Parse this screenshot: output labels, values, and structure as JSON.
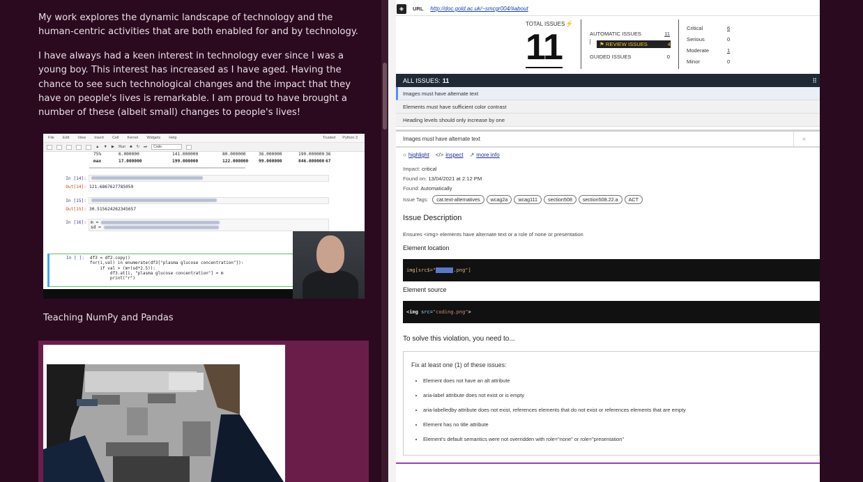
{
  "left": {
    "para1": "My work explores the dynamic landscape of technology and the human-centric activities that are both enabled for and by technology.",
    "para2": "I have always had a keen interest in technology ever since I was a young boy. This interest has increased as I have aged. Having the chance to see such technological changes and the impact that they have on people's lives is remarkable. I am proud to have brought a number of these (albeit small) changes to people's lives!",
    "caption": "Teaching NumPy and Pandas",
    "notebook": {
      "menu": [
        "File",
        "Edit",
        "View",
        "Insert",
        "Cell",
        "Kernel",
        "Widgets",
        "Help"
      ],
      "trusted": "Trusted",
      "kernel": "Python 3",
      "run_label": "Run",
      "cell_type": "Code",
      "table_rows": [
        {
          "label": "75%",
          "c1": "6.000000",
          "c2": "141.000000",
          "c3": "80.000000",
          "c4": "36.000000",
          "c5": "190.000000",
          "c6": "36"
        },
        {
          "label": "max",
          "c1": "17.000000",
          "c2": "199.000000",
          "c3": "122.000000",
          "c4": "99.000000",
          "c5": "846.000000",
          "c6": "67"
        }
      ],
      "in14": "In [14]:",
      "out14_label": "Out[14]:",
      "out14": "121.6867627785059",
      "in15": "In [15]:",
      "out15_label": "Out[15]:",
      "out15": "30.515624262345657",
      "in16": "In [16]:",
      "in16_line1": "m =",
      "in16_line2": "sd =",
      "in_active": "In [ ]:",
      "code_lines": [
        "df3 = df2.copy()",
        "for(i,val) in enumerate(df3[\"plasma glucose concentration\"]):",
        "    if val > (m+(sd*2.5)):",
        "        df3.at[i, \"plasma glucose concentration\"] = m",
        "        print(\"r\")"
      ]
    }
  },
  "checker": {
    "url_label": "URL",
    "url_value": "http://doc.gold.ac.uk/~smcgr004/#about",
    "total_label": "TOTAL ISSUES",
    "total_count": "11",
    "automatic_label": "AUTOMATIC ISSUES",
    "automatic_count": "11",
    "review_label": "REVIEW ISSUES",
    "review_count": "4",
    "guided_label": "GUIDED ISSUES",
    "guided_count": "0",
    "severity": [
      {
        "label": "Critical",
        "count": "6"
      },
      {
        "label": "Serious",
        "count": "0"
      },
      {
        "label": "Moderate",
        "count": "1"
      },
      {
        "label": "Minor",
        "count": "0"
      }
    ],
    "all_issues_label": "ALL ISSUES:",
    "all_issues_count": "11",
    "issues": [
      "Images must have alternate text",
      "Elements must have sufficient color contrast",
      "Heading levels should only increase by one"
    ],
    "detail_title": "Images must have alternate text",
    "actions": {
      "highlight": "highlight",
      "inspect": "inspect",
      "more_info": "more info"
    },
    "impact_label": "Impact:",
    "impact_value": "critical",
    "found_on_label": "Found on:",
    "found_on_value": "13/04/2021 at 2:12 PM",
    "found_label": "Found:",
    "found_value": "Automatically",
    "tags_label": "Issue Tags:",
    "tags": [
      "cat.text-alternatives",
      "wcag2a",
      "wcag111",
      "section508",
      "section508.22.a",
      "ACT"
    ],
    "issue_desc_title": "Issue Description",
    "issue_desc": "Ensures <img> elements have alternate text or a role of none or presentation",
    "element_location_title": "Element location",
    "element_location_pre": "img[src$=\"",
    "element_location_sel": "coding",
    "element_location_post": ".png\"]",
    "element_source_title": "Element source",
    "element_source_tag": "<img",
    "element_source_attr": " src=",
    "element_source_val": "\"coding.png\"",
    "element_source_end": ">",
    "solve_title": "To solve this violation, you need to...",
    "fix_title": "Fix at least one (1) of these issues:",
    "fixes": [
      "Element does not have an alt attribute",
      "aria-label attribute does not exist or is empty",
      "aria-labelledby attribute does not exist, references elements that do not exist or references elements that are empty",
      "Element has no title attribute",
      "Element's default semantics were not overridden with role=\"none\" or role=\"presentation\""
    ]
  }
}
